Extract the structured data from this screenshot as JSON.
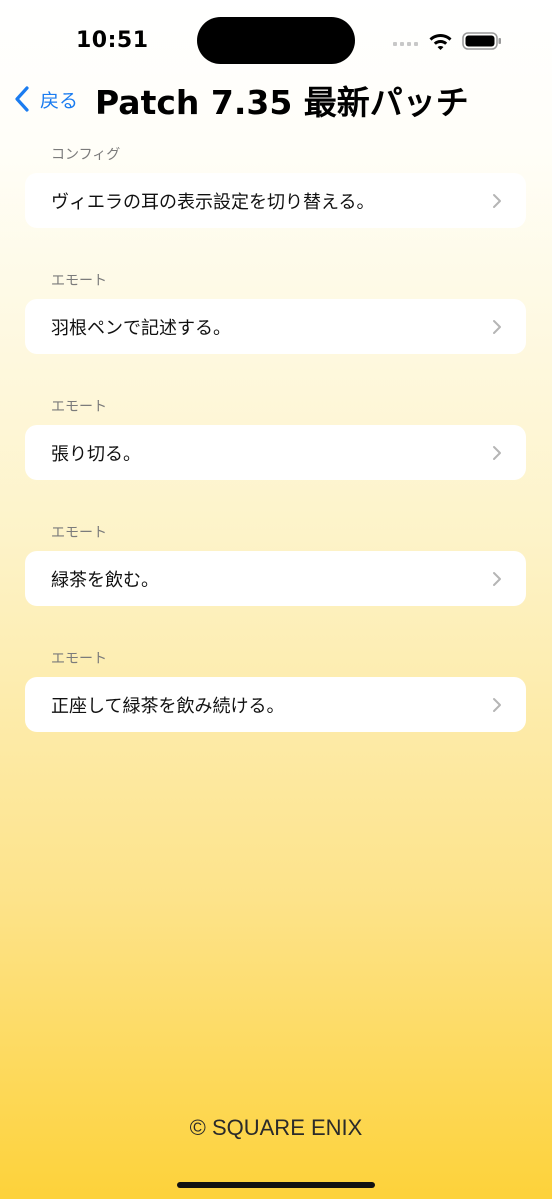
{
  "status_bar": {
    "time": "10:51"
  },
  "nav": {
    "back_label": "戻る",
    "title": "Patch 7.35 最新パッチ"
  },
  "sections": [
    {
      "header": "コンフィグ",
      "label": "ヴィエラの耳の表示設定を切り替える。"
    },
    {
      "header": "エモート",
      "label": "羽根ペンで記述する。"
    },
    {
      "header": "エモート",
      "label": "張り切る。"
    },
    {
      "header": "エモート",
      "label": "緑茶を飲む。"
    },
    {
      "header": "エモート",
      "label": "正座して緑茶を飲み続ける。"
    }
  ],
  "footer": {
    "copyright": "© SQUARE ENIX"
  },
  "colors": {
    "accent": "#1b7cf0",
    "gradient_bottom": "#fdd23a"
  }
}
